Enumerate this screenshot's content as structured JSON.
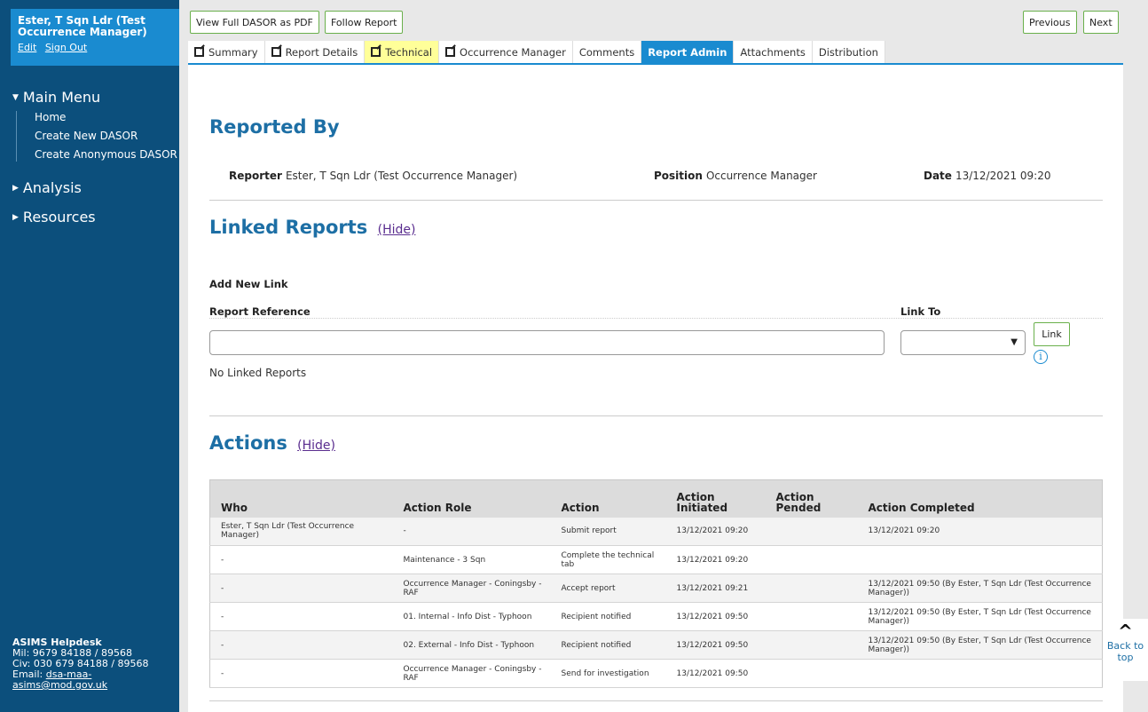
{
  "user": {
    "name": "Ester, T Sqn Ldr (Test Occurrence Manager)",
    "edit_label": "Edit",
    "signout_label": "Sign Out"
  },
  "menu": {
    "main_menu": "Main Menu",
    "items": [
      "Home",
      "Create New DASOR",
      "Create Anonymous DASOR"
    ],
    "analysis": "Analysis",
    "resources": "Resources"
  },
  "helpdesk": {
    "title": "ASIMS Helpdesk",
    "mil": "Mil: 9679 84188 / 89568",
    "civ": "Civ: 030 679 84188 / 89568",
    "email_label": "Email:",
    "email": "dsa-maa-asims@mod.gov.uk"
  },
  "toolbar": {
    "view_pdf": "View Full DASOR as PDF",
    "follow": "Follow Report",
    "previous": "Previous",
    "next": "Next"
  },
  "tabs": [
    "Summary",
    "Report Details",
    "Technical",
    "Occurrence Manager",
    "Comments",
    "Report Admin",
    "Attachments",
    "Distribution"
  ],
  "reported_by": {
    "title": "Reported By",
    "reporter_label": "Reporter",
    "reporter": "Ester, T Sqn Ldr (Test Occurrence Manager)",
    "position_label": "Position",
    "position": "Occurrence Manager",
    "date_label": "Date",
    "date": "13/12/2021 09:20"
  },
  "linked": {
    "title": "Linked Reports",
    "hide": "(Hide)",
    "add_new": "Add New Link",
    "ref_label": "Report Reference",
    "link_to_label": "Link To",
    "link_btn": "Link",
    "none": "No Linked Reports"
  },
  "actions": {
    "title": "Actions",
    "hide": "(Hide)",
    "headers": [
      "Who",
      "Action Role",
      "Action",
      "Action Initiated",
      "Action Pended",
      "Action Completed"
    ],
    "rows": [
      [
        "Ester, T Sqn Ldr (Test Occurrence Manager)",
        "-",
        "Submit report",
        "13/12/2021 09:20",
        "",
        "13/12/2021 09:20"
      ],
      [
        "-",
        "Maintenance - 3 Sqn",
        "Complete the technical tab",
        "13/12/2021 09:20",
        "",
        ""
      ],
      [
        "-",
        "Occurrence Manager - Coningsby - RAF",
        "Accept report",
        "13/12/2021 09:21",
        "",
        "13/12/2021 09:50 (By Ester, T Sqn Ldr (Test Occurrence Manager))"
      ],
      [
        "-",
        "01. Internal - Info Dist - Typhoon",
        "Recipient notified",
        "13/12/2021 09:50",
        "",
        "13/12/2021 09:50 (By Ester, T Sqn Ldr (Test Occurrence Manager))"
      ],
      [
        "-",
        "02. External - Info Dist - Typhoon",
        "Recipient notified",
        "13/12/2021 09:50",
        "",
        "13/12/2021 09:50 (By Ester, T Sqn Ldr (Test Occurrence Manager))"
      ],
      [
        "-",
        "Occurrence Manager - Coningsby - RAF",
        "Send for investigation",
        "13/12/2021 09:50",
        "",
        ""
      ]
    ]
  },
  "back_to_top": "Back to top"
}
